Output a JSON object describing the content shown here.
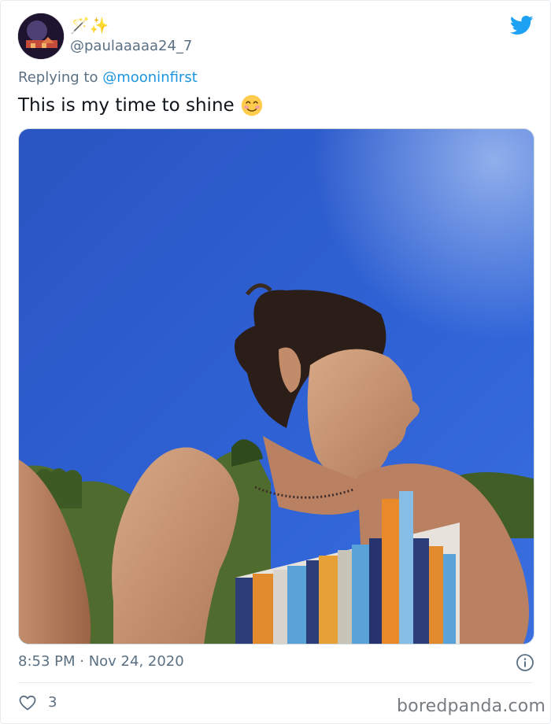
{
  "tweet": {
    "display_name": "🪄✨",
    "handle": "@paulaaaaa24_7",
    "replying_prefix": "Replying to",
    "replying_to": "@mooninfirst",
    "text": "This is my time to shine",
    "emoji": "smiling-face-icon",
    "timestamp": "8:53 PM · Nov 24, 2020",
    "like_count": "3"
  },
  "watermark": "boredpanda.com",
  "colors": {
    "accent": "#1da1f2",
    "link": "#1b95e0",
    "muted": "#5b7083",
    "text": "#0f1419",
    "sky": "#2f5fcc"
  }
}
